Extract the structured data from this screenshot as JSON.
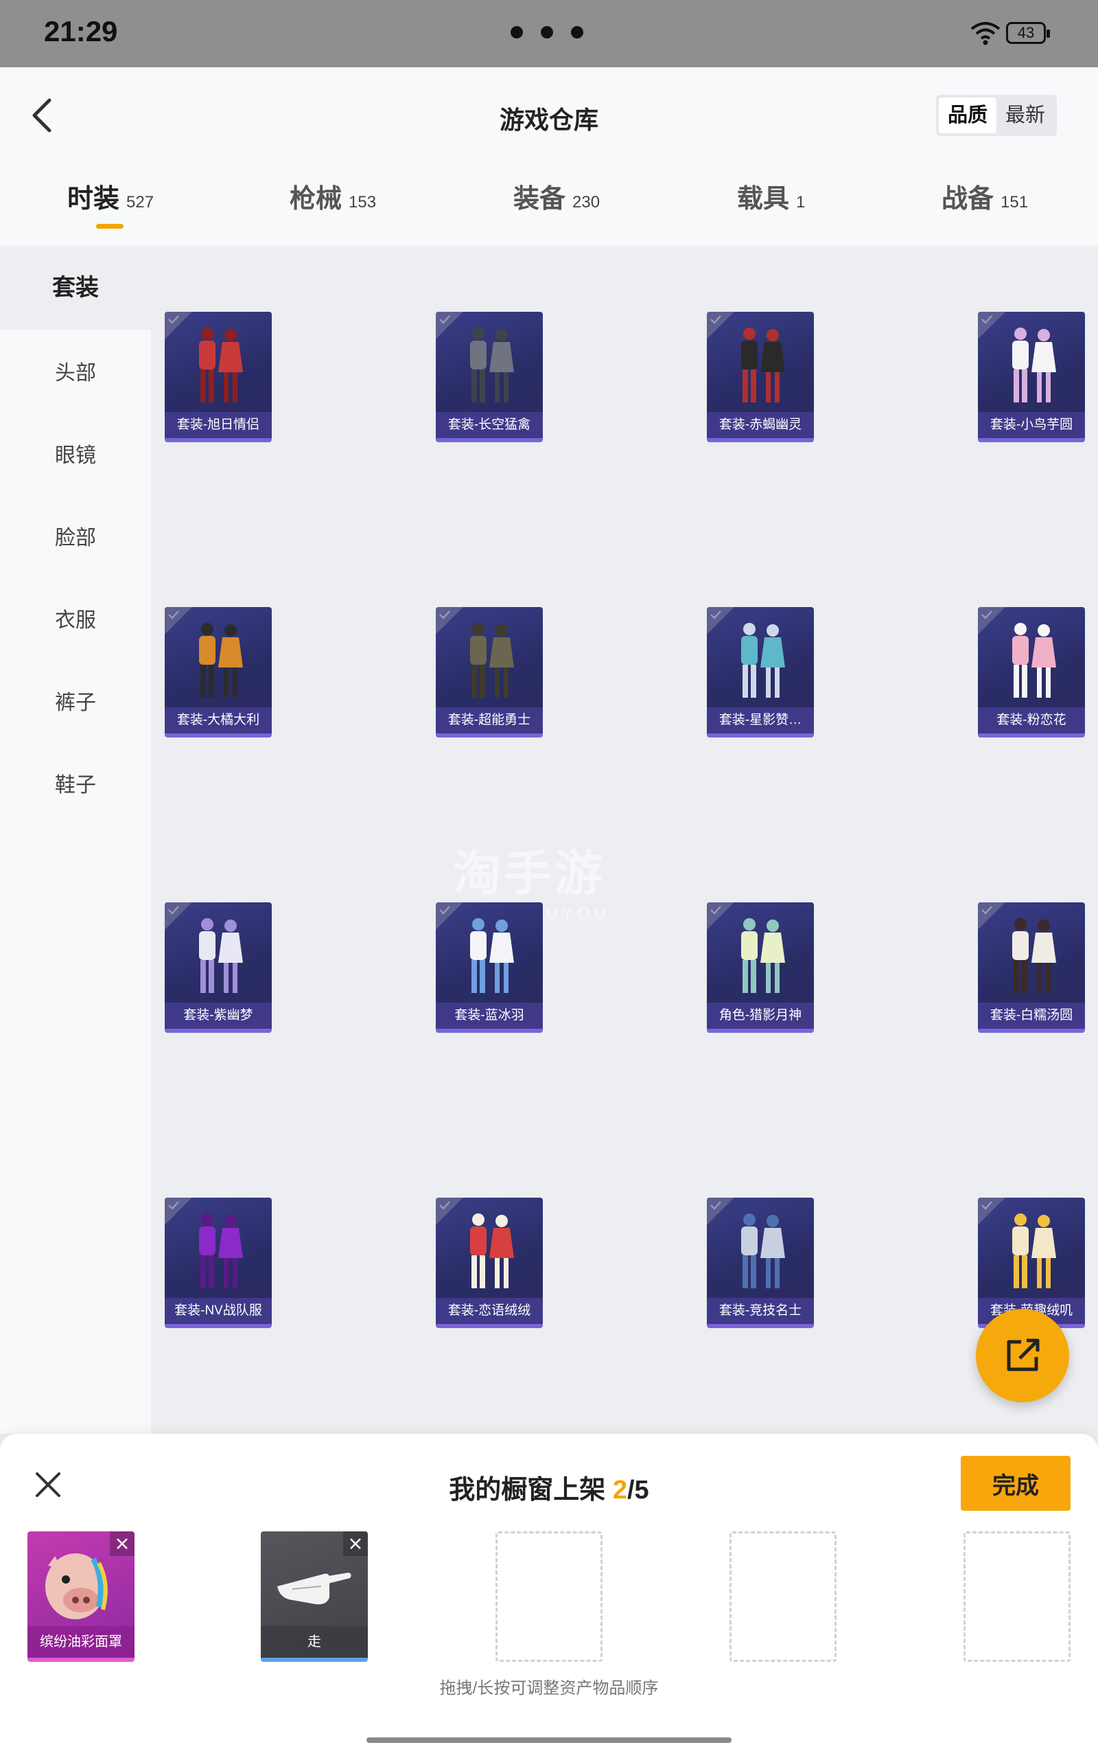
{
  "status_bar": {
    "time": "21:29",
    "battery": "43"
  },
  "header": {
    "title": "游戏仓库",
    "sort_options": [
      "品质",
      "最新"
    ],
    "active_sort": "品质"
  },
  "tabs": [
    {
      "name": "时装",
      "count": "527"
    },
    {
      "name": "枪械",
      "count": "153"
    },
    {
      "name": "装备",
      "count": "230"
    },
    {
      "name": "载具",
      "count": "1"
    },
    {
      "name": "战备",
      "count": "151"
    }
  ],
  "sidebar": [
    "套装",
    "头部",
    "眼镜",
    "脸部",
    "衣服",
    "裤子",
    "鞋子"
  ],
  "items": [
    {
      "label": "套装-旭日情侣",
      "icon": "red-tracksuit-outfit-icon"
    },
    {
      "label": "套装-长空猛禽",
      "icon": "camo-jacket-outfit-icon"
    },
    {
      "label": "套装-赤蝎幽灵",
      "icon": "black-leather-outfit-icon"
    },
    {
      "label": "套装-小鸟芋圆",
      "icon": "bird-costume-outfit-icon"
    },
    {
      "label": "套装-大橘大利",
      "icon": "orange-duo-outfit-icon"
    },
    {
      "label": "套装-超能勇士",
      "icon": "military-vest-outfit-icon"
    },
    {
      "label": "套装-星影赞…",
      "icon": "starlight-duo-outfit-icon"
    },
    {
      "label": "套装-粉恋花",
      "icon": "pink-flower-outfit-icon"
    },
    {
      "label": "套装-紫幽梦",
      "icon": "purple-dream-outfit-icon"
    },
    {
      "label": "套装-蓝冰羽",
      "icon": "blue-ice-outfit-icon"
    },
    {
      "label": "角色-猎影月神",
      "icon": "moon-goddess-character-icon"
    },
    {
      "label": "套装-白糯汤圆",
      "icon": "white-dumpling-outfit-icon"
    },
    {
      "label": "套装-NV战队服",
      "icon": "purple-team-outfit-icon"
    },
    {
      "label": "套装-恋语绒绒",
      "icon": "red-plush-outfit-icon"
    },
    {
      "label": "套装-竞技名士",
      "icon": "blue-suit-outfit-icon"
    },
    {
      "label": "套装-萌趣绒叽",
      "icon": "cute-chick-outfit-icon"
    }
  ],
  "watermark": {
    "main": "淘手游",
    "sub": "TAOSHOUYOU"
  },
  "bottom_sheet": {
    "title": "我的橱窗上架",
    "current": "2",
    "total": "/5",
    "done_label": "完成",
    "slots": [
      {
        "label": "缤纷油彩面罩",
        "icon": "pig-mask-icon"
      },
      {
        "label": "走",
        "icon": "pointing-hand-icon"
      }
    ],
    "empty_slots": 3,
    "hint": "拖拽/长按可调整资产物品顺序"
  },
  "colors": {
    "accent": "#f5a300",
    "card_bg": "#2e3070",
    "card_border": "#7a64d8"
  }
}
